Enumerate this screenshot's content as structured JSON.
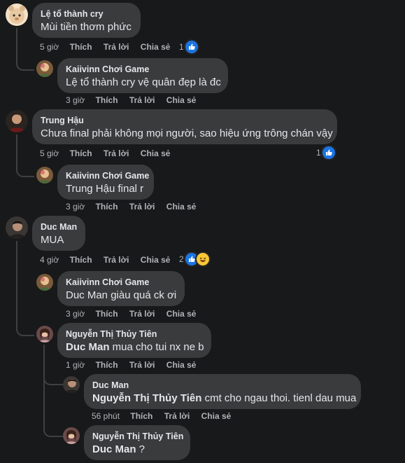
{
  "actions": {
    "like": "Thích",
    "reply": "Trả lời",
    "share": "Chia sẻ"
  },
  "comments": [
    {
      "name": "Lệ tổ thành cry",
      "text": "Mùi tiền thơm phức",
      "time": "5 giờ",
      "reactions": "1",
      "reaction_icons": [
        "like-icon"
      ]
    },
    {
      "name": "Kaiivinn Chơi Game",
      "text": "Lệ tổ thành cry vệ quân đẹp là đc",
      "time": "3 giờ"
    },
    {
      "name": "Trung Hậu",
      "text": "Chưa final phải không mọi người, sao hiệu ứng trông chán vậy",
      "time": "5 giờ",
      "reactions": "1",
      "reaction_icons": [
        "like-icon"
      ]
    },
    {
      "name": "Kaiivinn Chơi Game",
      "text": "Trung Hậu final r",
      "time": "3 giờ"
    },
    {
      "name": "Duc Man",
      "text": "MUA",
      "time": "4 giờ",
      "reactions": "2",
      "reaction_icons": [
        "like-icon",
        "haha-icon"
      ]
    },
    {
      "name": "Kaiivinn Chơi Game",
      "text": "Duc Man giàu quá ck ơi",
      "time": "3 giờ"
    },
    {
      "name": "Nguyễn Thị Thủy Tiên",
      "mention": "Duc Man",
      "text": " mua cho tui nx ne b",
      "time": "1 giờ"
    },
    {
      "name": "Duc Man",
      "mention": "Nguyễn Thị Thủy Tiên",
      "text": " cmt cho ngau thoi. tienl dau mua",
      "time": "56 phút"
    },
    {
      "name": "Nguyễn Thị Thủy Tiên",
      "mention": "Duc Man",
      "text": " ?",
      "time": ""
    }
  ],
  "colors": {
    "background": "#18191a",
    "bubble": "#3a3b3c",
    "like": "#1b74e4",
    "haha": "#f7c835"
  }
}
